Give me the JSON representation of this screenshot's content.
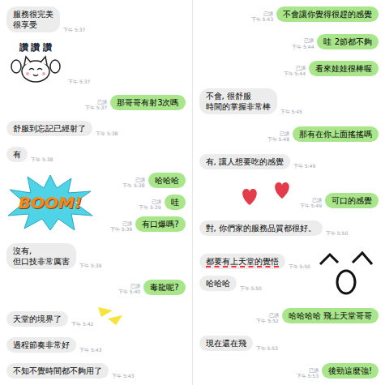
{
  "panels": [
    {
      "messages": [
        {
          "kind": "text",
          "side": "received",
          "text": "服務很完美\n很享受",
          "read": "",
          "time": "下午 5:37",
          "underlined": false
        },
        {
          "kind": "sticker",
          "side": "received",
          "text": "讚 讚 讚",
          "read": "",
          "time": "下午 5:37",
          "underlined": false
        },
        {
          "kind": "text",
          "side": "sent",
          "text": "那哥哥有射3次嗎",
          "read": "已讀",
          "time": "下午 5:37",
          "underlined": false
        },
        {
          "kind": "text",
          "side": "received",
          "text": "舒服到忘記已經射了",
          "read": "",
          "time": "下午 5:38",
          "underlined": false
        },
        {
          "kind": "text",
          "side": "received",
          "text": "有",
          "read": "",
          "time": "下午 5:38",
          "underlined": false
        },
        {
          "kind": "text",
          "side": "sent",
          "text": "哈哈哈",
          "read": "已讀",
          "time": "下午 5:38",
          "underlined": false
        },
        {
          "kind": "text",
          "side": "sent",
          "text": "哇",
          "read": "已讀",
          "time": "下午 5:39",
          "underlined": false
        },
        {
          "kind": "text",
          "side": "sent",
          "text": "有口爆嗎?",
          "read": "已讀",
          "time": "下午 5:39",
          "underlined": false
        },
        {
          "kind": "text",
          "side": "received",
          "text": "沒有,\n但口技非常厲害",
          "read": "",
          "time": "下午 5:39",
          "underlined": false
        },
        {
          "kind": "text",
          "side": "sent",
          "text": "毒龍呢?",
          "read": "已讀",
          "time": "下午 5:40",
          "underlined": false
        },
        {
          "kind": "text",
          "side": "received",
          "text": "天堂的境界了",
          "read": "",
          "time": "下午 5:42",
          "underlined": false
        },
        {
          "kind": "text",
          "side": "received",
          "text": "過程節奏非常好",
          "read": "",
          "time": "下午 5:43",
          "underlined": false
        },
        {
          "kind": "text",
          "side": "received",
          "text": "不知不覺時間都不夠用了",
          "read": "",
          "time": "下午 5:43",
          "underlined": false
        }
      ]
    },
    {
      "messages": [
        {
          "kind": "text",
          "side": "sent",
          "text": "不會讓你覺得很趕的感覺",
          "read": "已讀",
          "time": "下午 5:43",
          "underlined": false
        },
        {
          "kind": "text",
          "side": "sent",
          "text": "哇 2節都不夠",
          "read": "已讀",
          "time": "下午 5:44",
          "underlined": false
        },
        {
          "kind": "text",
          "side": "sent",
          "text": "看來娃娃很棒喔",
          "read": "已讀",
          "time": "下午 5:44",
          "underlined": false
        },
        {
          "kind": "text",
          "side": "received",
          "text": "不會, 很舒服\n時間的掌握非常棒",
          "read": "",
          "time": "下午 5:45",
          "underlined": false
        },
        {
          "kind": "text",
          "side": "sent",
          "text": "那有在你上面搖搖嗎",
          "read": "已讀",
          "time": "下午 5:48",
          "underlined": false
        },
        {
          "kind": "text",
          "side": "received",
          "text": "有, 讓人想要吃的感覺",
          "read": "",
          "time": "下午 5:49",
          "underlined": false
        },
        {
          "kind": "text",
          "side": "sent",
          "text": "可口的感覺",
          "read": "已讀",
          "time": "下午 5:49",
          "underlined": false
        },
        {
          "kind": "text",
          "side": "received",
          "text": "對, 你們家的服務品質都很好。",
          "read": "",
          "time": "下午 5:50",
          "underlined": false
        },
        {
          "kind": "text",
          "side": "received",
          "text": "都要有上天堂的覺悟",
          "read": "",
          "time": "下午 5:50",
          "underlined": true
        },
        {
          "kind": "text",
          "side": "received",
          "text": "哈哈哈",
          "read": "",
          "time": "下午 5:50",
          "underlined": false
        },
        {
          "kind": "text",
          "side": "sent",
          "text": "哈哈哈哈 飛上天堂哥哥",
          "read": "已讀",
          "time": "下午 5:52",
          "underlined": false
        },
        {
          "kind": "text",
          "side": "received",
          "text": "現在還在飛",
          "read": "",
          "time": "下午 5:53",
          "underlined": false
        },
        {
          "kind": "text",
          "side": "sent",
          "text": "後勁這麼強!",
          "read": "已讀",
          "time": "下午 5:53",
          "underlined": false
        }
      ]
    }
  ],
  "boom": {
    "text": "BOOM!"
  }
}
